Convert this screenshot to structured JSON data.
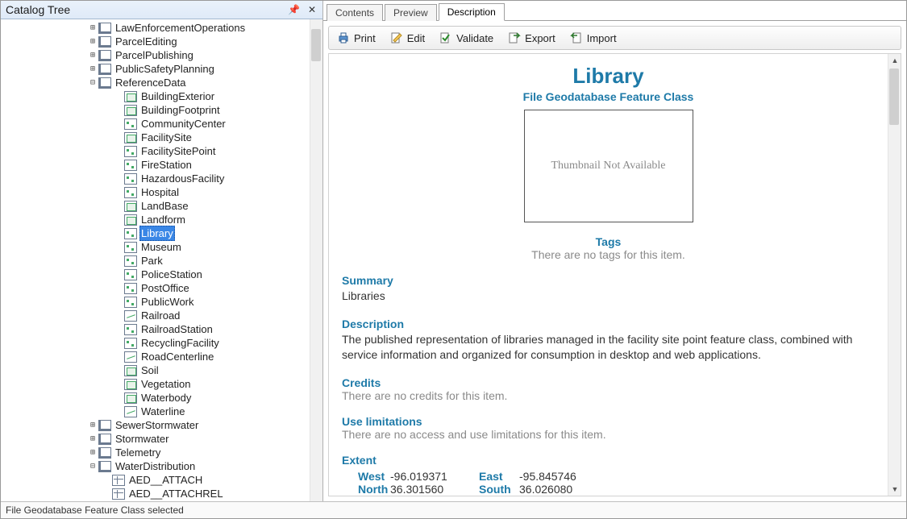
{
  "panel": {
    "title": "Catalog Tree"
  },
  "tree": {
    "top": [
      {
        "label": "LawEnforcementOperations",
        "toggle": "+",
        "type": "geo"
      },
      {
        "label": "ParcelEditing",
        "toggle": "+",
        "type": "geo"
      },
      {
        "label": "ParcelPublishing",
        "toggle": "+",
        "type": "geo"
      },
      {
        "label": "PublicSafetyPlanning",
        "toggle": "+",
        "type": "geo"
      },
      {
        "label": "ReferenceData",
        "toggle": "−",
        "type": "geo"
      }
    ],
    "ref_children": [
      {
        "label": "BuildingExterior",
        "type": "poly"
      },
      {
        "label": "BuildingFootprint",
        "type": "poly"
      },
      {
        "label": "CommunityCenter",
        "type": "point"
      },
      {
        "label": "FacilitySite",
        "type": "poly"
      },
      {
        "label": "FacilitySitePoint",
        "type": "point"
      },
      {
        "label": "FireStation",
        "type": "point"
      },
      {
        "label": "HazardousFacility",
        "type": "point"
      },
      {
        "label": "Hospital",
        "type": "point"
      },
      {
        "label": "LandBase",
        "type": "poly"
      },
      {
        "label": "Landform",
        "type": "poly"
      },
      {
        "label": "Library",
        "type": "point",
        "selected": true
      },
      {
        "label": "Museum",
        "type": "point"
      },
      {
        "label": "Park",
        "type": "point"
      },
      {
        "label": "PoliceStation",
        "type": "point"
      },
      {
        "label": "PostOffice",
        "type": "point"
      },
      {
        "label": "PublicWork",
        "type": "point"
      },
      {
        "label": "Railroad",
        "type": "line"
      },
      {
        "label": "RailroadStation",
        "type": "point"
      },
      {
        "label": "RecyclingFacility",
        "type": "point"
      },
      {
        "label": "RoadCenterline",
        "type": "line"
      },
      {
        "label": "Soil",
        "type": "poly"
      },
      {
        "label": "Vegetation",
        "type": "poly"
      },
      {
        "label": "Waterbody",
        "type": "poly"
      },
      {
        "label": "Waterline",
        "type": "line"
      }
    ],
    "bottom": [
      {
        "label": "SewerStormwater",
        "toggle": "+",
        "type": "geo"
      },
      {
        "label": "Stormwater",
        "toggle": "+",
        "type": "geo"
      },
      {
        "label": "Telemetry",
        "toggle": "+",
        "type": "geo"
      },
      {
        "label": "WaterDistribution",
        "toggle": "−",
        "type": "geo"
      }
    ],
    "wd_children": [
      {
        "label": "AED__ATTACH",
        "type": "table"
      },
      {
        "label": "AED__ATTACHREL",
        "type": "table"
      }
    ]
  },
  "tabs": {
    "items": [
      "Contents",
      "Preview",
      "Description"
    ],
    "active": 2
  },
  "toolbar": {
    "print": "Print",
    "edit": "Edit",
    "validate": "Validate",
    "export": "Export",
    "import": "Import"
  },
  "desc": {
    "title": "Library",
    "subtitle": "File Geodatabase Feature Class",
    "thumb": "Thumbnail Not Available",
    "tags_h": "Tags",
    "tags_v": "There are no tags for this item.",
    "summary_h": "Summary",
    "summary_v": "Libraries",
    "description_h": "Description",
    "description_v": "The published representation of libraries managed in the facility site point feature class, combined with service information and organized for consumption in desktop and web applications.",
    "credits_h": "Credits",
    "credits_v": "There are no credits for this item.",
    "uselim_h": "Use limitations",
    "uselim_v": "There are no access and use limitations for this item.",
    "extent_h": "Extent",
    "extent": {
      "west_l": "West",
      "west_v": "-96.019371",
      "east_l": "East",
      "east_v": "-95.845746",
      "north_l": "North",
      "north_v": "36.301560",
      "south_l": "South",
      "south_v": "36.026080"
    }
  },
  "status": "File Geodatabase Feature Class selected"
}
